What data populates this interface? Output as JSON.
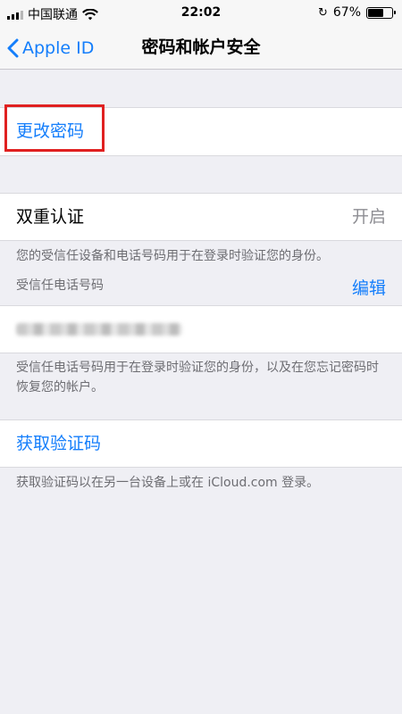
{
  "status_bar": {
    "carrier": "中国联通",
    "time": "22:02",
    "battery_percent": "67%",
    "battery_level": 0.67
  },
  "nav": {
    "back_label": "Apple ID",
    "title": "密码和帐户安全"
  },
  "change_password": {
    "label": "更改密码"
  },
  "two_factor": {
    "label": "双重认证",
    "value": "开启",
    "footnote": "您的受信任设备和电话号码用于在登录时验证您的身份。"
  },
  "trusted_phone": {
    "header": "受信任电话号码",
    "edit_label": "编辑",
    "footnote": "受信任电话号码用于在登录时验证您的身份，以及在您忘记密码时恢复您的帐户。"
  },
  "verification": {
    "label": "获取验证码",
    "footnote": "获取验证码以在另一台设备上或在 iCloud.com 登录。"
  },
  "colors": {
    "accent": "#147efb",
    "highlight": "#e02020",
    "background": "#efeff4"
  }
}
